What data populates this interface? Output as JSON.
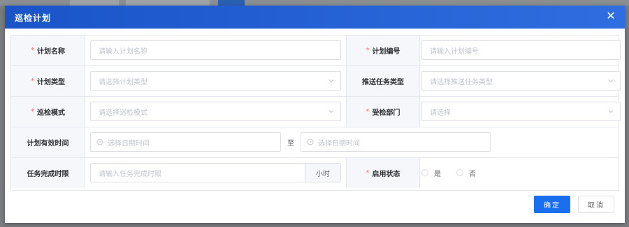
{
  "dialog": {
    "title": "巡检计划",
    "close_glyph": "✕"
  },
  "form": {
    "plan_name": {
      "label": "计划名称",
      "required_mark": "*",
      "placeholder": "请输入计划名称"
    },
    "plan_code": {
      "label": "计划编号",
      "required_mark": "*",
      "placeholder": "请输入计划编号"
    },
    "plan_type": {
      "label": "计划类型",
      "required_mark": "*",
      "placeholder": "请选择计划类型"
    },
    "push_task_type": {
      "label": "推送任务类型",
      "placeholder": "请选择推送任务类型"
    },
    "inspection_mode": {
      "label": "巡检模式",
      "required_mark": "*",
      "placeholder": "请选择巡检模式"
    },
    "inspected_dept": {
      "label": "受检部门",
      "required_mark": "*",
      "placeholder": "请选择"
    },
    "valid_time": {
      "label": "计划有效时间",
      "start_placeholder": "选择日期时间",
      "separator": "至",
      "end_placeholder": "选择日期时间"
    },
    "task_deadline": {
      "label": "任务完成时限",
      "placeholder": "请输入任务完成时限",
      "unit": "小时"
    },
    "enable_status": {
      "label": "启用状态",
      "required_mark": "*",
      "options": [
        "是",
        "否"
      ]
    }
  },
  "footer": {
    "confirm_label": "确定",
    "cancel_label": "取消"
  },
  "colors": {
    "header_start": "#1a54c8",
    "header_end": "#2f6ee0",
    "primary": "#1a6ef0",
    "required": "#f56c6c"
  }
}
